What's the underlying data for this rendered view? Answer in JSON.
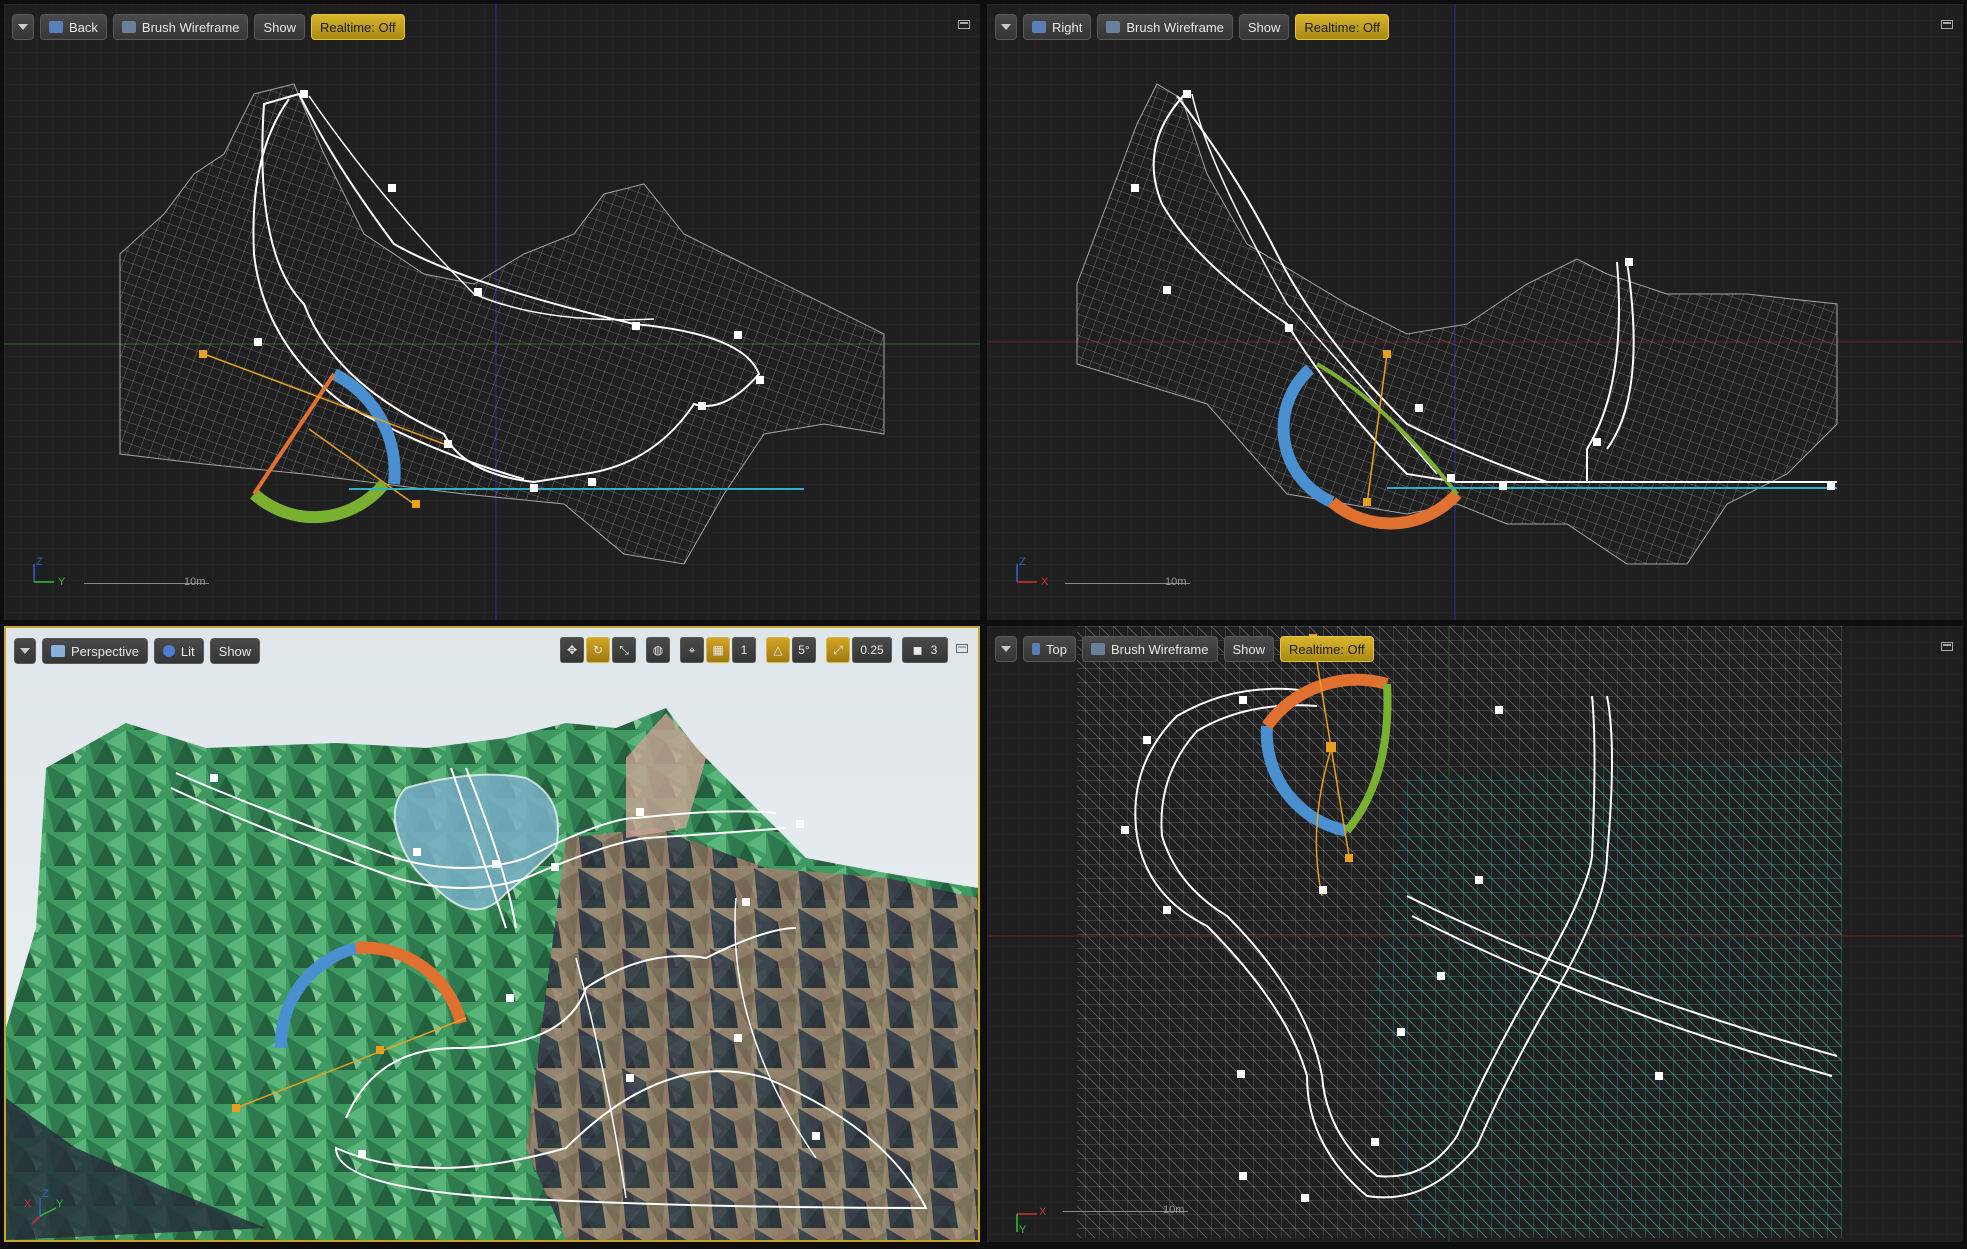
{
  "viewports": {
    "back": {
      "view_label": "Back",
      "mode_label": "Brush Wireframe",
      "show_label": "Show",
      "realtime_label": "Realtime: Off",
      "scale_label": "10m",
      "axis_labels": [
        "Z",
        "Y"
      ]
    },
    "right": {
      "view_label": "Right",
      "mode_label": "Brush Wireframe",
      "show_label": "Show",
      "realtime_label": "Realtime: Off",
      "scale_label": "10m",
      "axis_labels": [
        "Z",
        "X"
      ]
    },
    "perspective": {
      "view_label": "Perspective",
      "mode_label": "Lit",
      "show_label": "Show",
      "grid_snap_value": "1",
      "rotation_snap_value": "5°",
      "scale_snap_value": "0.25",
      "camera_speed_value": "3",
      "axis_labels": [
        "X",
        "Z",
        "Y"
      ]
    },
    "top": {
      "view_label": "Top",
      "mode_label": "Brush Wireframe",
      "show_label": "Show",
      "realtime_label": "Realtime: Off",
      "scale_label": "10m",
      "axis_labels": [
        "X",
        "Y"
      ]
    }
  },
  "colors": {
    "accent": "#c8a424",
    "spline": "#ffffff",
    "wireframe": "#9a9a9a",
    "arc_blue": "#4a90d0",
    "arc_orange": "#e07030",
    "arc_green": "#7ab030",
    "handle_orange": "#e8a020",
    "terrain_green": "#3a8a5a",
    "water": "#7ab0c8"
  },
  "icons": [
    "dropdown-icon",
    "camera-icon",
    "wireframe-icon",
    "lit-sphere-icon",
    "translate-icon",
    "rotate-icon",
    "scale-icon",
    "world-icon",
    "surface-snap-icon",
    "grid-snap-icon",
    "angle-snap-icon",
    "scale-snap-icon",
    "camera-speed-icon",
    "maximize-icon"
  ]
}
